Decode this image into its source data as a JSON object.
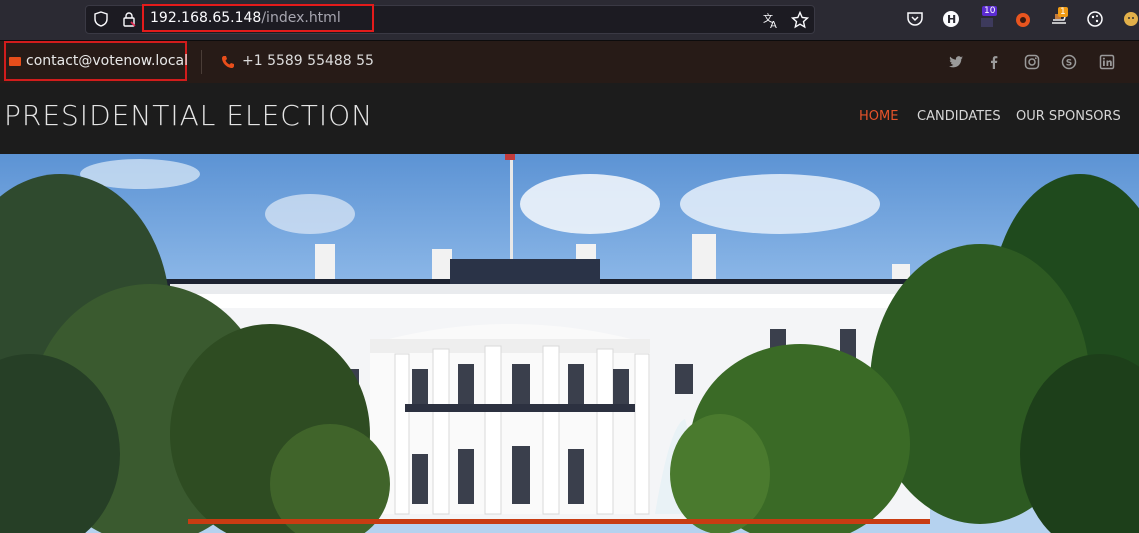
{
  "browser": {
    "url_host": "192.168.65.148",
    "url_path": "/index.html",
    "icons": [
      "shield-icon",
      "lock-icon",
      "translate-icon",
      "star-icon",
      "pocket-icon",
      "extension-h-icon",
      "extension-badge-icon",
      "extension-fox-icon",
      "extension-sled-icon",
      "extension-cookie-icon",
      "extension-face-icon"
    ],
    "badges": {
      "ext_count": "10",
      "ext_sled": "1"
    }
  },
  "topbar": {
    "email": "contact@votenow.local",
    "phone": "+1 5589 55488 55",
    "social": [
      "twitter-icon",
      "facebook-icon",
      "instagram-icon",
      "skype-icon",
      "linkedin-icon"
    ]
  },
  "header": {
    "logo": "PRESIDENTIAL ELECTION",
    "nav": [
      {
        "label": "HOME",
        "active": true
      },
      {
        "label": "CANDIDATES",
        "active": false
      },
      {
        "label": "OUR SPONSORS",
        "active": false
      }
    ]
  },
  "colors": {
    "accent": "#e6532a",
    "highlight_box": "#e31b1b",
    "topbar_bg": "#271b17",
    "header_bg": "#1c1c1c"
  }
}
